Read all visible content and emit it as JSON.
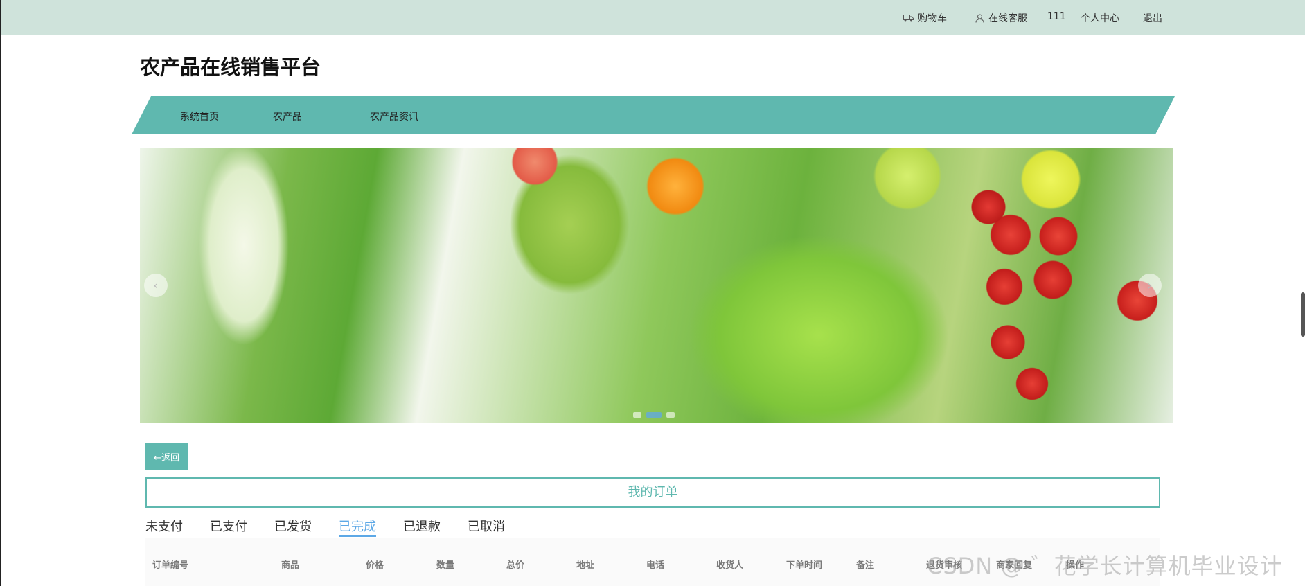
{
  "topbar": {
    "cart": "购物车",
    "service": "在线客服",
    "username": "111",
    "personal_center": "个人中心",
    "logout": "退出"
  },
  "site": {
    "title": "农产品在线销售平台"
  },
  "nav": {
    "items": [
      {
        "label": "系统首页"
      },
      {
        "label": "农产品"
      },
      {
        "label": "农产品资讯"
      }
    ]
  },
  "carousel": {
    "prev": "‹",
    "next": "›",
    "active_slide": 2,
    "slide_count": 3
  },
  "back_button": {
    "label": "←返回"
  },
  "orders": {
    "title": "我的订单",
    "tabs": [
      {
        "label": "未支付"
      },
      {
        "label": "已支付"
      },
      {
        "label": "已发货"
      },
      {
        "label": "已完成",
        "active": true
      },
      {
        "label": "已退款"
      },
      {
        "label": "已取消"
      }
    ],
    "columns": [
      "订单编号",
      "商品",
      "价格",
      "数量",
      "总价",
      "地址",
      "电话",
      "收货人",
      "下单时间",
      "备注",
      "退货审核",
      "商家回复",
      "操作"
    ]
  },
  "watermark": "CSDN @ ゛花学长计算机毕业设计",
  "colors": {
    "accent": "#5fb8af",
    "topbar": "#cfe3db",
    "active_tab": "#5da8e6"
  }
}
